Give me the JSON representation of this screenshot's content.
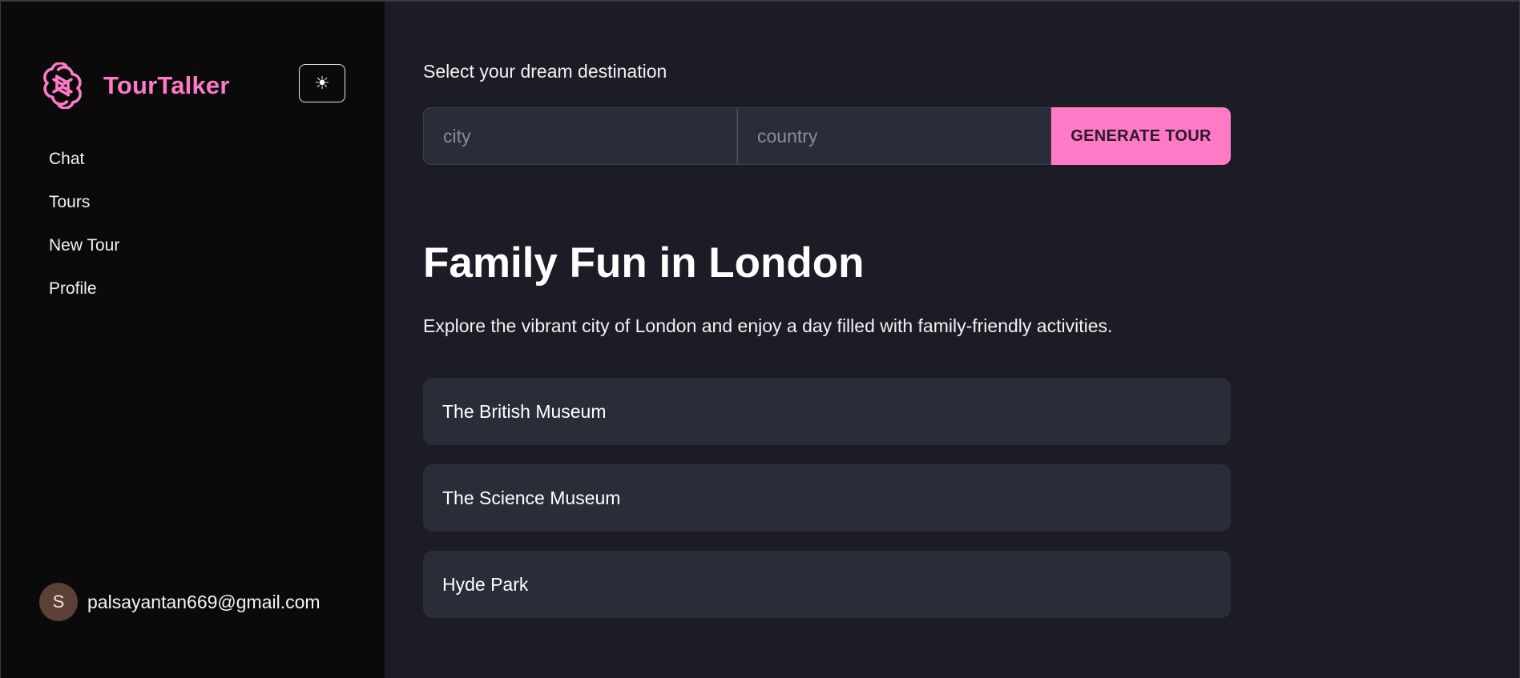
{
  "brand": {
    "name": "TourTalker",
    "accent_color": "#ff7ac6",
    "logo_icon": "openai-knot-icon"
  },
  "theme_toggle": {
    "icon": "sun-icon",
    "glyph": "☀"
  },
  "nav": {
    "items": [
      {
        "label": "Chat"
      },
      {
        "label": "Tours"
      },
      {
        "label": "New Tour"
      },
      {
        "label": "Profile"
      }
    ]
  },
  "user": {
    "initial": "S",
    "email": "palsayantan669@gmail.com"
  },
  "search": {
    "label": "Select your dream destination",
    "city_placeholder": "city",
    "city_value": "",
    "country_placeholder": "country",
    "country_value": "",
    "button_label": "GENERATE TOUR"
  },
  "tour": {
    "title": "Family Fun in London",
    "description": "Explore the vibrant city of London and enjoy a day filled with family-friendly activities.",
    "stops": [
      {
        "name": "The British Museum"
      },
      {
        "name": "The Science Museum"
      },
      {
        "name": "Hyde Park"
      }
    ]
  }
}
